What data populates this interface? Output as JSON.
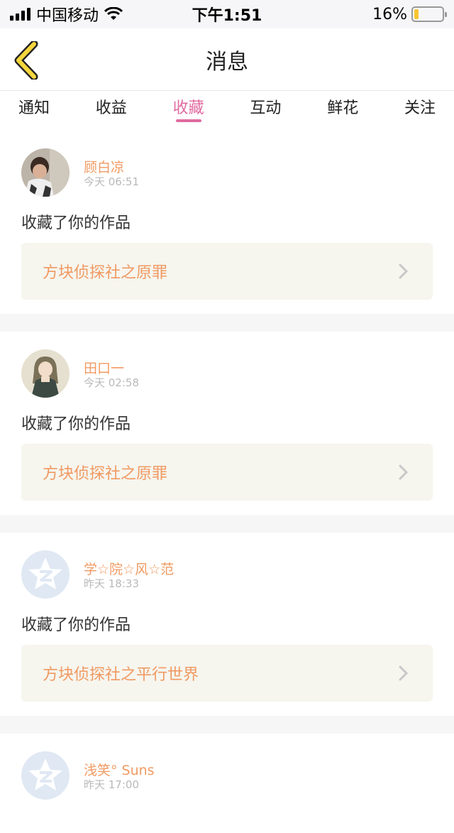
{
  "status_bar": {
    "carrier": "中国移动",
    "time": "下午1:51",
    "battery": "16%",
    "battery_level": 0.16
  },
  "nav": {
    "title": "消息",
    "back_icon": "back-chevron-icon"
  },
  "tabs": [
    {
      "label": "通知"
    },
    {
      "label": "收益"
    },
    {
      "label": "收藏",
      "active": true
    },
    {
      "label": "互动"
    },
    {
      "label": "鲜花"
    },
    {
      "label": "关注"
    }
  ],
  "feed": [
    {
      "user": "顾白凉",
      "time": "今天 06:51",
      "action": "收藏了你的作品",
      "work": "方块侦探社之原罪",
      "avatar": "photo-avatar"
    },
    {
      "user": "田口一",
      "time": "今天 02:58",
      "action": "收藏了你的作品",
      "work": "方块侦探社之原罪",
      "avatar": "anime-avatar"
    },
    {
      "user": "学☆院☆风☆范",
      "time": "昨天 18:33",
      "action": "收藏了你的作品",
      "work": "方块侦探社之平行世界",
      "avatar": "default-avatar"
    },
    {
      "user": "浅笑° Suns",
      "time": "昨天 17:00",
      "action": "",
      "work": "",
      "avatar": "default-avatar"
    }
  ],
  "colors": {
    "accent": "#e06aa0",
    "name": "#f09a62",
    "link_bg": "#f6f5ee",
    "back_icon": "#f5d63c"
  }
}
